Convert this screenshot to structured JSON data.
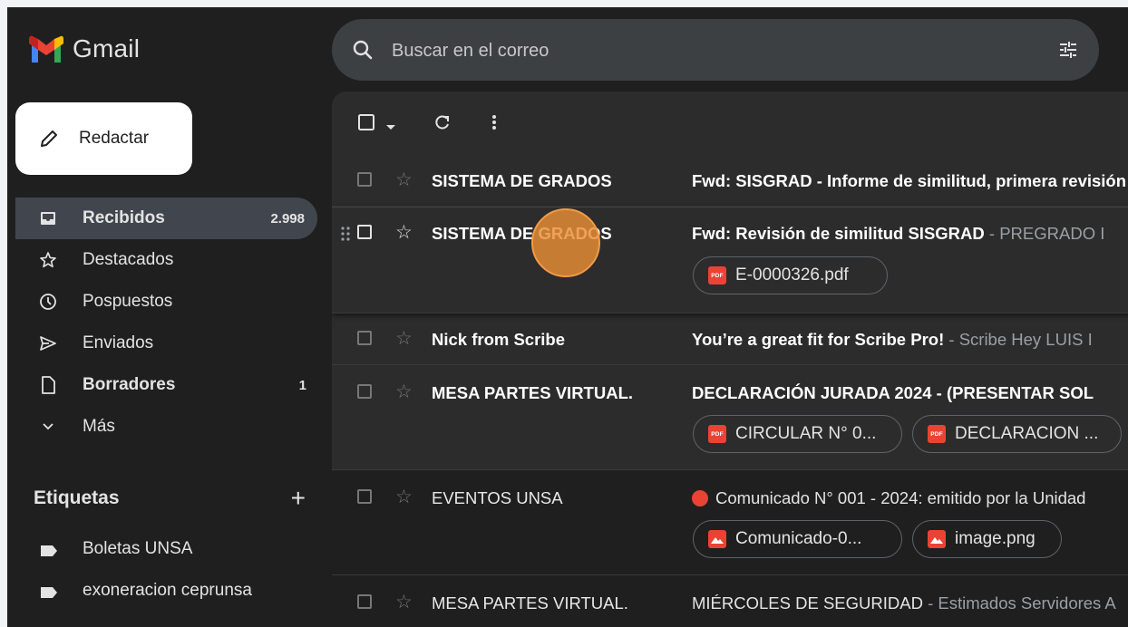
{
  "app": {
    "name": "Gmail"
  },
  "colors": {
    "accent": "#ea4335",
    "background": "#1f1f1f",
    "panel": "#2c2c2c",
    "active_nav": "#41464e",
    "cursor": "#e98e35"
  },
  "compose": {
    "label": "Redactar",
    "icon": "pencil-icon"
  },
  "nav": [
    {
      "label": "Recibidos",
      "count": "2.998",
      "icon": "inbox-icon",
      "active": true
    },
    {
      "label": "Destacados",
      "count": "",
      "icon": "star-icon"
    },
    {
      "label": "Pospuestos",
      "count": "",
      "icon": "clock-icon"
    },
    {
      "label": "Enviados",
      "count": "",
      "icon": "send-icon"
    },
    {
      "label": "Borradores",
      "count": "1",
      "icon": "draft-icon"
    },
    {
      "label": "Más",
      "count": "",
      "icon": "chevron-down-icon"
    }
  ],
  "labels": {
    "title": "Etiquetas",
    "add": "+",
    "items": [
      {
        "label": "Boletas UNSA",
        "icon": "label-icon"
      },
      {
        "label": "exoneracion ceprunsa",
        "icon": "label-icon"
      }
    ]
  },
  "search": {
    "placeholder": "Buscar en el correo",
    "icon": "search-icon",
    "filter_icon": "tune-icon"
  },
  "toolbar": {
    "icons": [
      "checkbox-icon",
      "dropdown-arrow-icon",
      "refresh-icon",
      "more-vert-icon"
    ]
  },
  "emails": [
    {
      "sender": "SISTEMA DE GRADOS",
      "subject": "Fwd: SISGRAD - Informe de similitud, primera revisión",
      "snippet": "",
      "unread": true,
      "attachments": []
    },
    {
      "sender": "SISTEMA DE GRADOS",
      "subject": "Fwd: Revisión de similitud SISGRAD",
      "snippet": " - PREGRADO I",
      "unread": true,
      "attachments": [
        {
          "name": "E-0000326.pdf",
          "type": "pdf"
        }
      ]
    },
    {
      "sender": "Nick from Scribe",
      "subject": "You’re a great fit for Scribe Pro!",
      "snippet": " - Scribe Hey LUIS I",
      "unread": true,
      "attachments": []
    },
    {
      "sender": "MESA PARTES VIRTUAL.",
      "subject": "DECLARACIÓN JURADA 2024 - (PRESENTAR SOL",
      "snippet": "",
      "unread": true,
      "attachments": [
        {
          "name": "CIRCULAR N° 0...",
          "type": "pdf"
        },
        {
          "name": "DECLARACION ...",
          "type": "pdf"
        }
      ]
    },
    {
      "sender": "EVENTOS UNSA",
      "subject": "Comunicado N° 001 - 2024: emitido por la Unidad",
      "snippet": "",
      "unread": false,
      "attachments": [
        {
          "name": "Comunicado-0...",
          "type": "image"
        },
        {
          "name": "image.png",
          "type": "image"
        }
      ]
    },
    {
      "sender": "MESA PARTES VIRTUAL.",
      "subject": "MIÉRCOLES DE SEGURIDAD",
      "snippet": " - Estimados Servidores A",
      "unread": false,
      "attachments": []
    }
  ]
}
